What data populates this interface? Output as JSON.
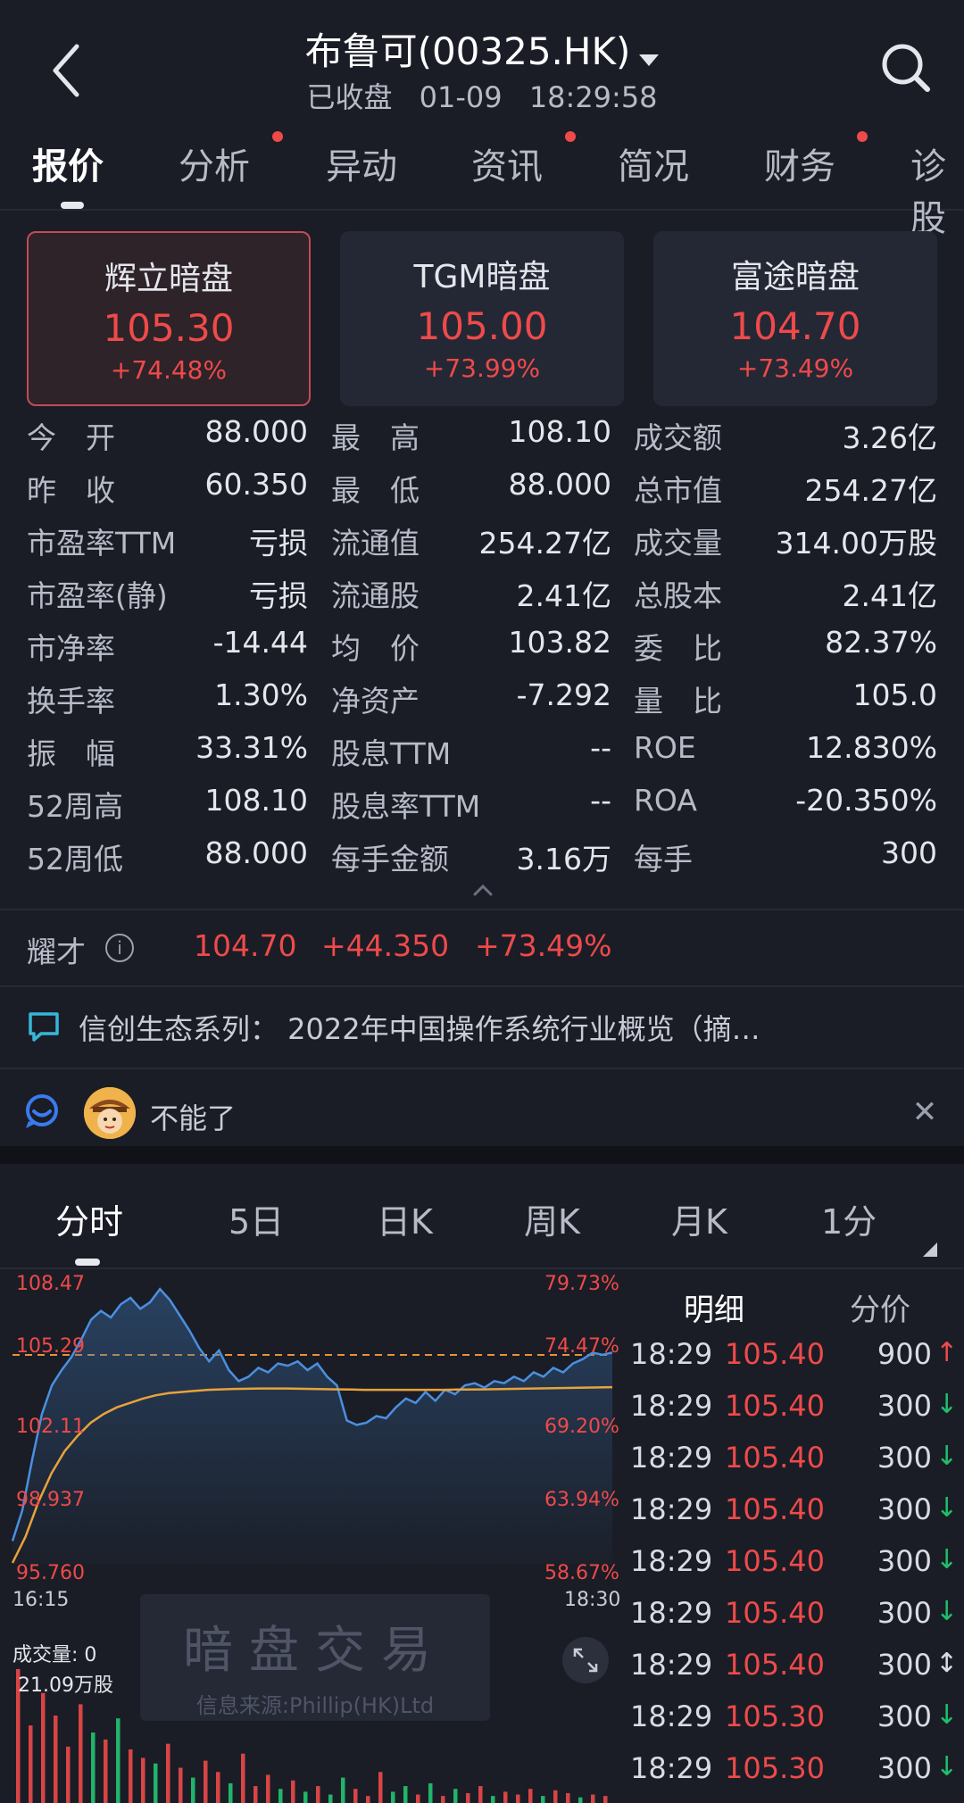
{
  "header": {
    "title": "布鲁可(00325.HK)",
    "status": "已收盘",
    "date": "01-09",
    "time": "18:29:58"
  },
  "tabs": [
    {
      "label": "报价",
      "active": true,
      "dot": false
    },
    {
      "label": "分析",
      "active": false,
      "dot": true
    },
    {
      "label": "异动",
      "active": false,
      "dot": false
    },
    {
      "label": "资讯",
      "active": false,
      "dot": true
    },
    {
      "label": "简况",
      "active": false,
      "dot": false
    },
    {
      "label": "财务",
      "active": false,
      "dot": true
    },
    {
      "label": "诊股",
      "active": false,
      "dot": false
    }
  ],
  "dark_pools": [
    {
      "name": "辉立暗盘",
      "price": "105.30",
      "change": "+74.48%",
      "active": true
    },
    {
      "name": "TGM暗盘",
      "price": "105.00",
      "change": "+73.99%",
      "active": false
    },
    {
      "name": "富途暗盘",
      "price": "104.70",
      "change": "+73.49%",
      "active": false
    }
  ],
  "stats": [
    [
      {
        "label": "今　开",
        "value": "88.000",
        "color": "red"
      },
      {
        "label": "最　高",
        "value": "108.10",
        "color": "red"
      },
      {
        "label": "成交额",
        "value": "3.26亿",
        "color": "white"
      }
    ],
    [
      {
        "label": "昨　收",
        "value": "60.350",
        "color": "white"
      },
      {
        "label": "最　低",
        "value": "88.000",
        "color": "red"
      },
      {
        "label": "总市值",
        "value": "254.27亿",
        "color": "white"
      }
    ],
    [
      {
        "label": "市盈率TTM",
        "value": "亏损",
        "color": "white"
      },
      {
        "label": "流通值",
        "value": "254.27亿",
        "color": "white"
      },
      {
        "label": "成交量",
        "value": "314.00万股",
        "color": "white"
      }
    ],
    [
      {
        "label": "市盈率(静)",
        "value": "亏损",
        "color": "white"
      },
      {
        "label": "流通股",
        "value": "2.41亿",
        "color": "white"
      },
      {
        "label": "总股本",
        "value": "2.41亿",
        "color": "white"
      }
    ],
    [
      {
        "label": "市净率",
        "value": "-14.44",
        "color": "white"
      },
      {
        "label": "均　价",
        "value": "103.82",
        "color": "white"
      },
      {
        "label": "委　比",
        "value": "82.37%",
        "color": "white"
      }
    ],
    [
      {
        "label": "换手率",
        "value": "1.30%",
        "color": "white"
      },
      {
        "label": "净资产",
        "value": "-7.292",
        "color": "white"
      },
      {
        "label": "量　比",
        "value": "105.0",
        "color": "white"
      }
    ],
    [
      {
        "label": "振　幅",
        "value": "33.31%",
        "color": "white"
      },
      {
        "label": "股息TTM",
        "value": "--",
        "color": "white"
      },
      {
        "label": "ROE",
        "value": "12.830%",
        "color": "white"
      }
    ],
    [
      {
        "label": "52周高",
        "value": "108.10",
        "color": "white"
      },
      {
        "label": "股息率TTM",
        "value": "--",
        "color": "white"
      },
      {
        "label": "ROA",
        "value": "-20.350%",
        "color": "white"
      }
    ],
    [
      {
        "label": "52周低",
        "value": "88.000",
        "color": "white"
      },
      {
        "label": "每手金额",
        "value": "3.16万",
        "color": "white"
      },
      {
        "label": "每手",
        "value": "300",
        "color": "white"
      }
    ]
  ],
  "after_hours": {
    "label": "耀才",
    "price": "104.70",
    "change": "+44.350",
    "pct": "+73.49%"
  },
  "news": {
    "text": "信创生态系列：  2022年中国操作系统行业概览（摘…"
  },
  "chat": {
    "text": "不能了"
  },
  "chart_tabs": [
    {
      "label": "分时",
      "active": true
    },
    {
      "label": "5日",
      "active": false
    },
    {
      "label": "日K",
      "active": false
    },
    {
      "label": "周K",
      "active": false
    },
    {
      "label": "月K",
      "active": false
    },
    {
      "label": "1分",
      "active": false
    }
  ],
  "chart_axis": {
    "prices": [
      "108.47",
      "105.29",
      "102.11",
      "98.937",
      "95.760"
    ],
    "pcts": [
      "79.73%",
      "74.47%",
      "69.20%",
      "63.94%",
      "58.67%"
    ],
    "start_time": "16:15",
    "end_time": "18:30",
    "volume_label": "成交量: 0",
    "volume_max": "21.09万股"
  },
  "watermark": {
    "title": "暗盘交易",
    "source": "信息来源:Phillip(HK)Ltd"
  },
  "detail": {
    "head_left": "明细",
    "head_right": "分价",
    "rows": [
      {
        "time": "18:29",
        "price": "105.40",
        "vol": "900",
        "dir": "up"
      },
      {
        "time": "18:29",
        "price": "105.40",
        "vol": "300",
        "dir": "down"
      },
      {
        "time": "18:29",
        "price": "105.40",
        "vol": "300",
        "dir": "down"
      },
      {
        "time": "18:29",
        "price": "105.40",
        "vol": "300",
        "dir": "down"
      },
      {
        "time": "18:29",
        "price": "105.40",
        "vol": "300",
        "dir": "down"
      },
      {
        "time": "18:29",
        "price": "105.40",
        "vol": "300",
        "dir": "down"
      },
      {
        "time": "18:29",
        "price": "105.40",
        "vol": "300",
        "dir": "both"
      },
      {
        "time": "18:29",
        "price": "105.30",
        "vol": "300",
        "dir": "down"
      },
      {
        "time": "18:29",
        "price": "105.30",
        "vol": "300",
        "dir": "down"
      }
    ]
  },
  "chart_data": {
    "type": "line",
    "x_range": [
      "16:15",
      "18:30"
    ],
    "ylim": [
      95.76,
      108.47
    ],
    "prev_close": 60.35,
    "reference_price": 105.29,
    "series": [
      {
        "values": [
          96.8,
          98.2,
          100.5,
          102.6,
          103.9,
          104.6,
          105.2,
          106.0,
          106.9,
          107.3,
          107.0,
          107.6,
          107.9,
          107.4,
          107.7,
          108.3,
          107.8,
          107.1,
          106.4,
          105.6,
          105.0,
          105.5,
          104.6,
          104.1,
          104.3,
          104.7,
          104.5,
          104.9,
          104.8,
          105.0,
          104.6,
          104.9,
          104.3,
          103.9,
          102.3,
          102.1,
          102.2,
          102.5,
          102.4,
          102.9,
          103.3,
          103.1,
          103.6,
          103.2,
          103.7,
          103.5,
          103.9,
          104.0,
          103.8,
          104.1,
          104.0,
          104.3,
          104.1,
          104.5,
          104.3,
          104.7,
          104.5,
          104.9,
          105.1,
          105.4,
          105.3,
          105.4
        ]
      },
      {
        "values": [
          95.8,
          97.0,
          98.6,
          99.9,
          100.9,
          101.6,
          102.2,
          102.6,
          102.9,
          103.1,
          103.3,
          103.45,
          103.55,
          103.6,
          103.65,
          103.7,
          103.72,
          103.74,
          103.75,
          103.76,
          103.76,
          103.76,
          103.75,
          103.74,
          103.73,
          103.72,
          103.71,
          103.7,
          103.7,
          103.7,
          103.7,
          103.7,
          103.7,
          103.7,
          103.71,
          103.71,
          103.72,
          103.73,
          103.74,
          103.75,
          103.76,
          103.77,
          103.78,
          103.79,
          103.8,
          103.81,
          103.82
        ]
      }
    ],
    "volume": {
      "max": "21.09万股",
      "bars": [
        {
          "v": 0.95,
          "c": "red"
        },
        {
          "v": 0.55,
          "c": "red"
        },
        {
          "v": 0.78,
          "c": "red"
        },
        {
          "v": 0.62,
          "c": "red"
        },
        {
          "v": 0.4,
          "c": "red"
        },
        {
          "v": 0.7,
          "c": "red"
        },
        {
          "v": 0.5,
          "c": "green"
        },
        {
          "v": 0.45,
          "c": "red"
        },
        {
          "v": 0.6,
          "c": "green"
        },
        {
          "v": 0.38,
          "c": "red"
        },
        {
          "v": 0.32,
          "c": "red"
        },
        {
          "v": 0.28,
          "c": "green"
        },
        {
          "v": 0.42,
          "c": "red"
        },
        {
          "v": 0.25,
          "c": "red"
        },
        {
          "v": 0.18,
          "c": "green"
        },
        {
          "v": 0.3,
          "c": "red"
        },
        {
          "v": 0.22,
          "c": "red"
        },
        {
          "v": 0.14,
          "c": "green"
        },
        {
          "v": 0.35,
          "c": "red"
        },
        {
          "v": 0.12,
          "c": "red"
        },
        {
          "v": 0.2,
          "c": "red"
        },
        {
          "v": 0.1,
          "c": "green"
        },
        {
          "v": 0.16,
          "c": "red"
        },
        {
          "v": 0.08,
          "c": "green"
        },
        {
          "v": 0.12,
          "c": "red"
        },
        {
          "v": 0.06,
          "c": "green"
        },
        {
          "v": 0.18,
          "c": "green"
        },
        {
          "v": 0.1,
          "c": "red"
        },
        {
          "v": 0.05,
          "c": "red"
        },
        {
          "v": 0.22,
          "c": "red"
        },
        {
          "v": 0.08,
          "c": "green"
        },
        {
          "v": 0.12,
          "c": "green"
        },
        {
          "v": 0.06,
          "c": "red"
        },
        {
          "v": 0.14,
          "c": "green"
        },
        {
          "v": 0.05,
          "c": "red"
        },
        {
          "v": 0.1,
          "c": "green"
        },
        {
          "v": 0.07,
          "c": "red"
        },
        {
          "v": 0.12,
          "c": "red"
        },
        {
          "v": 0.05,
          "c": "green"
        },
        {
          "v": 0.08,
          "c": "red"
        },
        {
          "v": 0.06,
          "c": "red"
        },
        {
          "v": 0.1,
          "c": "red"
        },
        {
          "v": 0.05,
          "c": "green"
        },
        {
          "v": 0.09,
          "c": "red"
        },
        {
          "v": 0.07,
          "c": "red"
        },
        {
          "v": 0.04,
          "c": "green"
        },
        {
          "v": 0.06,
          "c": "red"
        },
        {
          "v": 0.05,
          "c": "red"
        }
      ]
    }
  }
}
